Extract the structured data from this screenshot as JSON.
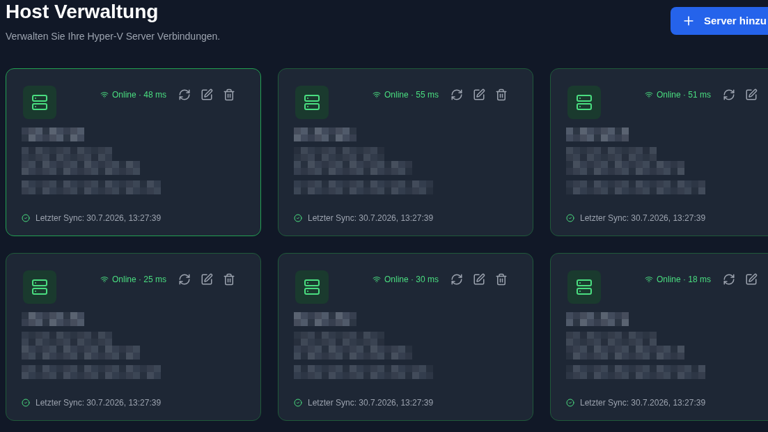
{
  "header": {
    "title": "Host Verwaltung",
    "subtitle": "Verwalten Sie Ihre Hyper-V Server Verbindungen.",
    "add_button": "Server hinzu"
  },
  "servers": [
    {
      "online": true,
      "status": "Online · 48 ms",
      "last_sync": "Letzter Sync: 30.7.2026, 13:27:39",
      "highlighted": true,
      "actions": [
        {
          "kind": "sync"
        },
        {
          "kind": "edit"
        },
        {
          "kind": "delete"
        }
      ]
    },
    {
      "online": true,
      "status": "Online · 55 ms",
      "last_sync": "Letzter Sync: 30.7.2026, 13:27:39",
      "highlighted": false,
      "actions": [
        {
          "kind": "sync"
        },
        {
          "kind": "edit"
        },
        {
          "kind": "delete"
        }
      ]
    },
    {
      "online": true,
      "status": "Online · 51 ms",
      "last_sync": "Letzter Sync: 30.7.2026, 13:27:39",
      "highlighted": false,
      "actions": [
        {
          "kind": "sync"
        },
        {
          "kind": "edit"
        }
      ]
    },
    {
      "online": true,
      "status": "Online · 25 ms",
      "last_sync": "Letzter Sync: 30.7.2026, 13:27:39",
      "highlighted": false,
      "actions": [
        {
          "kind": "sync"
        },
        {
          "kind": "edit"
        },
        {
          "kind": "delete"
        }
      ]
    },
    {
      "online": true,
      "status": "Online · 30 ms",
      "last_sync": "Letzter Sync: 30.7.2026, 13:27:39",
      "highlighted": false,
      "actions": [
        {
          "kind": "sync"
        },
        {
          "kind": "edit"
        },
        {
          "kind": "delete"
        }
      ]
    },
    {
      "online": true,
      "status": "Online · 18 ms",
      "last_sync": "Letzter Sync: 30.7.2026, 13:27:39",
      "highlighted": false,
      "actions": [
        {
          "kind": "sync"
        },
        {
          "kind": "edit"
        }
      ]
    }
  ]
}
